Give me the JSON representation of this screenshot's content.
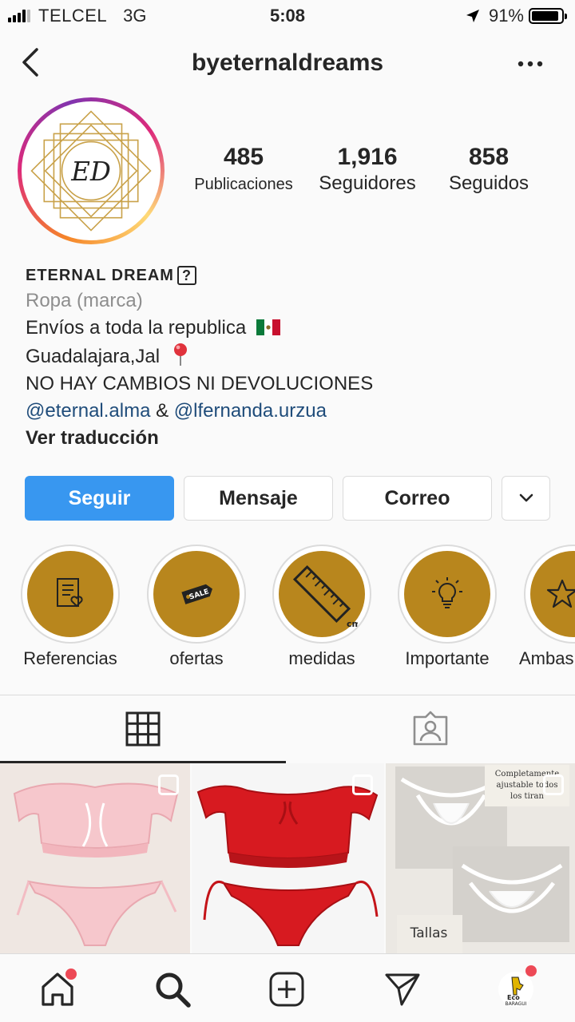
{
  "status_bar": {
    "carrier": "TELCEL",
    "network": "3G",
    "time": "5:08",
    "battery_percent": "91%",
    "battery_level": 0.91
  },
  "header": {
    "username": "byeternaldreams",
    "back_icon": "chevron-left-icon",
    "more_icon": "more-horizontal-icon"
  },
  "profile": {
    "avatar_monogram": "ED",
    "stats": [
      {
        "value": "485",
        "label": "Publicaciones"
      },
      {
        "value": "1,916",
        "label": "Seguidores"
      },
      {
        "value": "858",
        "label": "Seguidos"
      }
    ],
    "name": "ETERNAL DREAM",
    "name_badge": "?",
    "category": "Ropa (marca)",
    "bio_line1": "Envíos a toda la republica",
    "bio_line2": "Guadalajara,Jal",
    "bio_line3": "NO HAY CAMBIOS NI DEVOLUCIONES",
    "mention1": "@eternal.alma",
    "mention_sep": " & ",
    "mention2": "@lfernanda.urzua",
    "translate": "Ver traducción"
  },
  "actions": {
    "follow": "Seguir",
    "message": "Mensaje",
    "email": "Correo",
    "dropdown_icon": "chevron-down-icon"
  },
  "highlights": [
    {
      "label": "Referencias",
      "icon": "clipboard-heart-icon"
    },
    {
      "label": "ofertas",
      "icon": "sale-tag-icon"
    },
    {
      "label": "medidas",
      "icon": "ruler-icon"
    },
    {
      "label": "Importante",
      "icon": "lightbulb-icon"
    },
    {
      "label": "Ambas",
      "icon": "star-icon"
    }
  ],
  "tabs": [
    {
      "icon": "grid-icon",
      "active": true
    },
    {
      "icon": "tagged-person-icon",
      "active": false
    }
  ],
  "posts": [
    {
      "name": "pink-lingerie-post",
      "bg": "#efe7e2"
    },
    {
      "name": "red-lingerie-post",
      "bg": "#f6f6f6"
    },
    {
      "name": "white-lace-post",
      "bg": "#ebe8e3",
      "text_top": "Completamente ajustable todos los tiran",
      "text_bottom": "Tallas"
    }
  ],
  "bottom_nav": [
    "home-icon",
    "search-icon",
    "new-post-icon",
    "activity-icon",
    "profile-avatar-icon"
  ],
  "colors": {
    "accent": "#3897f0",
    "highlight_gold": "#b8861d",
    "notification": "#ed4956",
    "link": "#1f4c7a"
  },
  "profile_avatar_text": "Eco BARAGUI"
}
